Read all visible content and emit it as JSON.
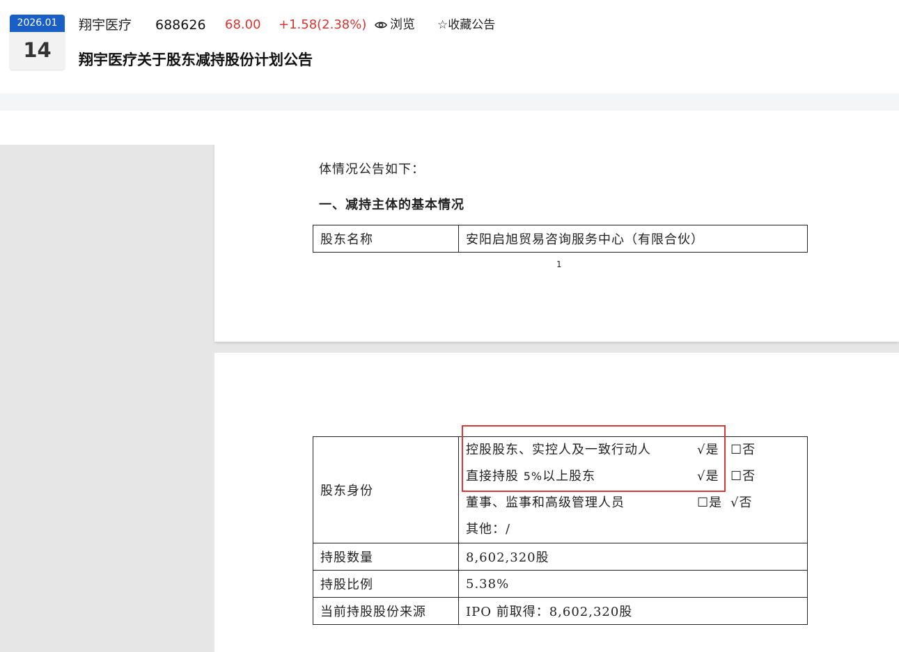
{
  "header": {
    "date_ym": "2026.01",
    "date_day": "14",
    "stock_name": "翔宇医疗",
    "stock_code": "688626",
    "price": "68.00",
    "change": "+1.58(2.38%)",
    "browse_label": "浏览",
    "favorite_label": "☆收藏公告",
    "title": "翔宇医疗关于股东减持股份计划公告",
    "price_color": "#d9322e",
    "date_badge_color": "#1a5fc6"
  },
  "document": {
    "page1": {
      "paragraph_tail": "体情况公告如下：",
      "section_heading": "一、减持主体的基本情况",
      "table": [
        {
          "key": "股东名称",
          "value": "安阳启旭贸易咨询服务中心（有限合伙）"
        }
      ],
      "page_number": "1"
    },
    "page2": {
      "identity_label": "股东身份",
      "identity_rows": [
        {
          "label_pre": "控股股东、实控人及一致行动人",
          "label_mid": "",
          "label_post": "",
          "yes": "√是",
          "no": "☐否"
        },
        {
          "label_pre": "直接持股 ",
          "label_mid": "5%",
          "label_post": "以上股东",
          "yes": "√是",
          "no": "☐否"
        },
        {
          "label_pre": "董事、监事和高级管理人员",
          "label_mid": "",
          "label_post": "",
          "yes": "☐是",
          "no": "√否"
        },
        {
          "label_pre": "其他：/",
          "label_mid": "",
          "label_post": "",
          "yes": "",
          "no": ""
        }
      ],
      "rows": [
        {
          "key": "持股数量",
          "value": "8,602,320股"
        },
        {
          "key": "持股比例",
          "value": "5.38%"
        },
        {
          "key": "当前持股股份来源",
          "value": "IPO 前取得：8,602,320股"
        }
      ]
    }
  },
  "icons": {
    "browse": "eye-icon",
    "favorite": "star-outline-icon"
  }
}
